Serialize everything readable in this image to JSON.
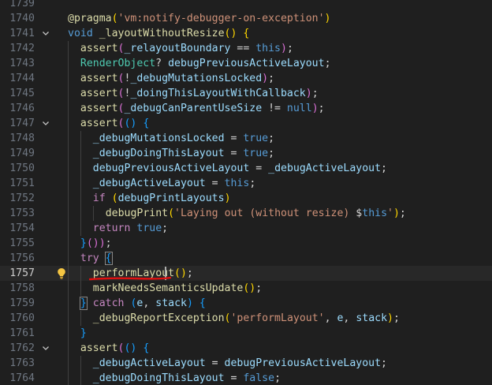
{
  "editor": {
    "active_line": "1757",
    "lines": [
      {
        "num": "1739",
        "fold": "",
        "bulb": false,
        "indent": 0,
        "tokens": []
      },
      {
        "num": "1740",
        "fold": "",
        "bulb": false,
        "indent": 0,
        "tokens": [
          {
            "t": "@pragma",
            "c": "t-ann"
          },
          {
            "t": "(",
            "c": "t-brace"
          },
          {
            "t": "'vm:notify-debugger-on-exception'",
            "c": "t-str"
          },
          {
            "t": ")",
            "c": "t-brace"
          }
        ]
      },
      {
        "num": "1741",
        "fold": "v",
        "bulb": false,
        "indent": 0,
        "tokens": [
          {
            "t": "void",
            "c": "t-kw"
          },
          {
            "t": " ",
            "c": "t-plain"
          },
          {
            "t": "_layoutWithoutResize",
            "c": "t-fn"
          },
          {
            "t": "()",
            "c": "t-brace"
          },
          {
            "t": " ",
            "c": "t-plain"
          },
          {
            "t": "{",
            "c": "t-brace"
          }
        ]
      },
      {
        "num": "1742",
        "fold": "",
        "bulb": false,
        "indent": 1,
        "tokens": [
          {
            "t": "assert",
            "c": "t-fn"
          },
          {
            "t": "(",
            "c": "t-brace2"
          },
          {
            "t": "_relayoutBoundary",
            "c": "t-var"
          },
          {
            "t": " == ",
            "c": "t-op"
          },
          {
            "t": "this",
            "c": "t-kw"
          },
          {
            "t": ")",
            "c": "t-brace2"
          },
          {
            "t": ";",
            "c": "t-plain"
          }
        ]
      },
      {
        "num": "1743",
        "fold": "",
        "bulb": false,
        "indent": 1,
        "tokens": [
          {
            "t": "RenderObject",
            "c": "t-type"
          },
          {
            "t": "? ",
            "c": "t-plain"
          },
          {
            "t": "debugPreviousActiveLayout",
            "c": "t-var"
          },
          {
            "t": ";",
            "c": "t-plain"
          }
        ]
      },
      {
        "num": "1744",
        "fold": "",
        "bulb": false,
        "indent": 1,
        "tokens": [
          {
            "t": "assert",
            "c": "t-fn"
          },
          {
            "t": "(",
            "c": "t-brace2"
          },
          {
            "t": "!",
            "c": "t-op"
          },
          {
            "t": "_debugMutationsLocked",
            "c": "t-var"
          },
          {
            "t": ")",
            "c": "t-brace2"
          },
          {
            "t": ";",
            "c": "t-plain"
          }
        ]
      },
      {
        "num": "1745",
        "fold": "",
        "bulb": false,
        "indent": 1,
        "tokens": [
          {
            "t": "assert",
            "c": "t-fn"
          },
          {
            "t": "(",
            "c": "t-brace2"
          },
          {
            "t": "!",
            "c": "t-op"
          },
          {
            "t": "_doingThisLayoutWithCallback",
            "c": "t-var"
          },
          {
            "t": ")",
            "c": "t-brace2"
          },
          {
            "t": ";",
            "c": "t-plain"
          }
        ]
      },
      {
        "num": "1746",
        "fold": "",
        "bulb": false,
        "indent": 1,
        "tokens": [
          {
            "t": "assert",
            "c": "t-fn"
          },
          {
            "t": "(",
            "c": "t-brace2"
          },
          {
            "t": "_debugCanParentUseSize",
            "c": "t-var"
          },
          {
            "t": " != ",
            "c": "t-op"
          },
          {
            "t": "null",
            "c": "t-kw"
          },
          {
            "t": ")",
            "c": "t-brace2"
          },
          {
            "t": ";",
            "c": "t-plain"
          }
        ]
      },
      {
        "num": "1747",
        "fold": "v",
        "bulb": false,
        "indent": 1,
        "tokens": [
          {
            "t": "assert",
            "c": "t-fn"
          },
          {
            "t": "(",
            "c": "t-brace2"
          },
          {
            "t": "()",
            "c": "t-brace3"
          },
          {
            "t": " ",
            "c": "t-plain"
          },
          {
            "t": "{",
            "c": "t-brace3"
          }
        ]
      },
      {
        "num": "1748",
        "fold": "",
        "bulb": false,
        "indent": 2,
        "tokens": [
          {
            "t": "_debugMutationsLocked",
            "c": "t-var"
          },
          {
            "t": " = ",
            "c": "t-op"
          },
          {
            "t": "true",
            "c": "t-kw"
          },
          {
            "t": ";",
            "c": "t-plain"
          }
        ]
      },
      {
        "num": "1749",
        "fold": "",
        "bulb": false,
        "indent": 2,
        "tokens": [
          {
            "t": "_debugDoingThisLayout",
            "c": "t-var"
          },
          {
            "t": " = ",
            "c": "t-op"
          },
          {
            "t": "true",
            "c": "t-kw"
          },
          {
            "t": ";",
            "c": "t-plain"
          }
        ]
      },
      {
        "num": "1750",
        "fold": "",
        "bulb": false,
        "indent": 2,
        "tokens": [
          {
            "t": "debugPreviousActiveLayout",
            "c": "t-var"
          },
          {
            "t": " = ",
            "c": "t-op"
          },
          {
            "t": "_debugActiveLayout",
            "c": "t-var"
          },
          {
            "t": ";",
            "c": "t-plain"
          }
        ]
      },
      {
        "num": "1751",
        "fold": "",
        "bulb": false,
        "indent": 2,
        "tokens": [
          {
            "t": "_debugActiveLayout",
            "c": "t-var"
          },
          {
            "t": " = ",
            "c": "t-op"
          },
          {
            "t": "this",
            "c": "t-kw"
          },
          {
            "t": ";",
            "c": "t-plain"
          }
        ]
      },
      {
        "num": "1752",
        "fold": "",
        "bulb": false,
        "indent": 2,
        "tokens": [
          {
            "t": "if",
            "c": "t-ctrl"
          },
          {
            "t": " ",
            "c": "t-plain"
          },
          {
            "t": "(",
            "c": "t-brace"
          },
          {
            "t": "debugPrintLayouts",
            "c": "t-var"
          },
          {
            "t": ")",
            "c": "t-brace"
          }
        ]
      },
      {
        "num": "1753",
        "fold": "",
        "bulb": false,
        "indent": 3,
        "tokens": [
          {
            "t": "debugPrint",
            "c": "t-fn"
          },
          {
            "t": "(",
            "c": "t-brace"
          },
          {
            "t": "'Laying out (without resize) ",
            "c": "t-str"
          },
          {
            "t": "$",
            "c": "t-plain"
          },
          {
            "t": "this",
            "c": "t-kw"
          },
          {
            "t": "'",
            "c": "t-str"
          },
          {
            "t": ")",
            "c": "t-brace"
          },
          {
            "t": ";",
            "c": "t-plain"
          }
        ]
      },
      {
        "num": "1754",
        "fold": "",
        "bulb": false,
        "indent": 2,
        "tokens": [
          {
            "t": "return",
            "c": "t-ctrl"
          },
          {
            "t": " ",
            "c": "t-plain"
          },
          {
            "t": "true",
            "c": "t-kw"
          },
          {
            "t": ";",
            "c": "t-plain"
          }
        ]
      },
      {
        "num": "1755",
        "fold": "",
        "bulb": false,
        "indent": 1,
        "tokens": [
          {
            "t": "}",
            "c": "t-brace3"
          },
          {
            "t": "())",
            "c": "t-brace2"
          },
          {
            "t": ";",
            "c": "t-plain"
          }
        ]
      },
      {
        "num": "1756",
        "fold": "",
        "bulb": false,
        "indent": 1,
        "tokens": [
          {
            "t": "try",
            "c": "t-ctrl"
          },
          {
            "t": " ",
            "c": "t-plain"
          },
          {
            "t": "{",
            "c": "t-brace3",
            "hl": true
          }
        ]
      },
      {
        "num": "1757",
        "fold": "",
        "bulb": true,
        "indent": 2,
        "tokens": [
          {
            "t": "performLayout",
            "c": "t-fn"
          },
          {
            "t": "()",
            "c": "t-brace"
          },
          {
            "t": ";",
            "c": "t-plain"
          }
        ]
      },
      {
        "num": "1758",
        "fold": "",
        "bulb": false,
        "indent": 2,
        "tokens": [
          {
            "t": "markNeedsSemanticsUpdate",
            "c": "t-fn"
          },
          {
            "t": "()",
            "c": "t-brace"
          },
          {
            "t": ";",
            "c": "t-plain"
          }
        ]
      },
      {
        "num": "1759",
        "fold": "",
        "bulb": false,
        "indent": 1,
        "tokens": [
          {
            "t": "}",
            "c": "t-brace3",
            "hl": true
          },
          {
            "t": " ",
            "c": "t-plain"
          },
          {
            "t": "catch",
            "c": "t-ctrl"
          },
          {
            "t": " ",
            "c": "t-plain"
          },
          {
            "t": "(",
            "c": "t-brace3"
          },
          {
            "t": "e",
            "c": "t-var"
          },
          {
            "t": ", ",
            "c": "t-plain"
          },
          {
            "t": "stack",
            "c": "t-var"
          },
          {
            "t": ")",
            "c": "t-brace3"
          },
          {
            "t": " ",
            "c": "t-plain"
          },
          {
            "t": "{",
            "c": "t-brace3"
          }
        ]
      },
      {
        "num": "1760",
        "fold": "",
        "bulb": false,
        "indent": 2,
        "tokens": [
          {
            "t": "_debugReportException",
            "c": "t-fn"
          },
          {
            "t": "(",
            "c": "t-brace"
          },
          {
            "t": "'performLayout'",
            "c": "t-str"
          },
          {
            "t": ", ",
            "c": "t-plain"
          },
          {
            "t": "e",
            "c": "t-var"
          },
          {
            "t": ", ",
            "c": "t-plain"
          },
          {
            "t": "stack",
            "c": "t-var"
          },
          {
            "t": ")",
            "c": "t-brace"
          },
          {
            "t": ";",
            "c": "t-plain"
          }
        ]
      },
      {
        "num": "1761",
        "fold": "",
        "bulb": false,
        "indent": 1,
        "tokens": [
          {
            "t": "}",
            "c": "t-brace3"
          }
        ]
      },
      {
        "num": "1762",
        "fold": "v",
        "bulb": false,
        "indent": 1,
        "tokens": [
          {
            "t": "assert",
            "c": "t-fn"
          },
          {
            "t": "(",
            "c": "t-brace2"
          },
          {
            "t": "()",
            "c": "t-brace3"
          },
          {
            "t": " ",
            "c": "t-plain"
          },
          {
            "t": "{",
            "c": "t-brace3"
          }
        ]
      },
      {
        "num": "1763",
        "fold": "",
        "bulb": false,
        "indent": 2,
        "tokens": [
          {
            "t": "_debugActiveLayout",
            "c": "t-var"
          },
          {
            "t": " = ",
            "c": "t-op"
          },
          {
            "t": "debugPreviousActiveLayout",
            "c": "t-var"
          },
          {
            "t": ";",
            "c": "t-plain"
          }
        ]
      },
      {
        "num": "1764",
        "fold": "",
        "bulb": false,
        "indent": 2,
        "tokens": [
          {
            "t": "_debugDoingThisLayout",
            "c": "t-var"
          },
          {
            "t": " = ",
            "c": "t-op"
          },
          {
            "t": "false",
            "c": "t-kw"
          },
          {
            "t": ";",
            "c": "t-plain"
          }
        ]
      }
    ]
  },
  "colors": {
    "background": "#1f1f1f",
    "active_line": "#282828",
    "annotation_underline": "#e01010",
    "lightbulb": "#f4c542"
  },
  "icons": {
    "fold": "chevron-down-icon",
    "bulb": "lightbulb-icon"
  }
}
